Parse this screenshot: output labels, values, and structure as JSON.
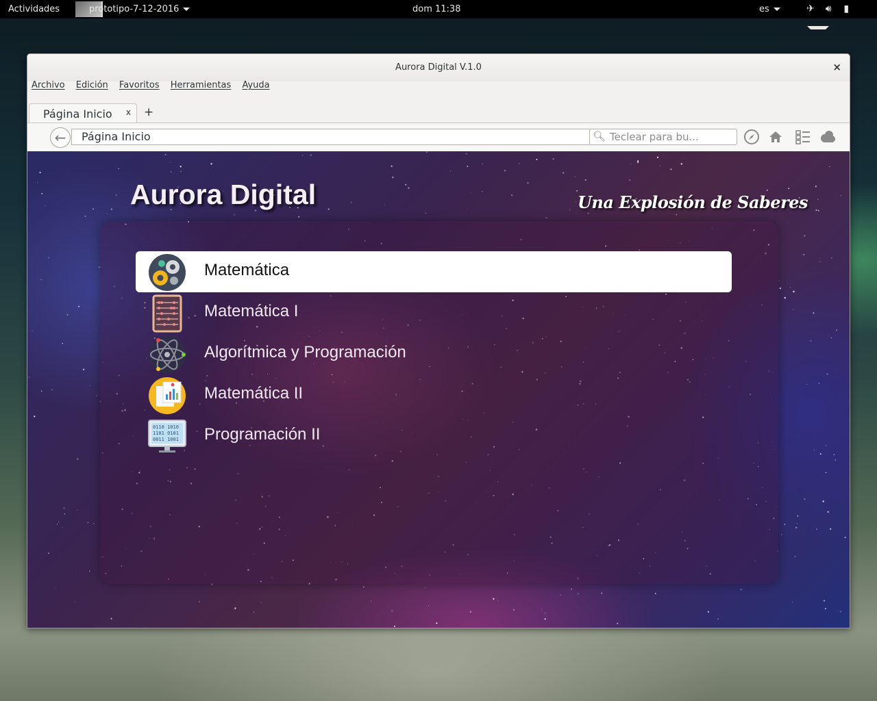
{
  "topbar": {
    "activities": "Actividades",
    "app_name": "prototipo-7-12-2016",
    "clock": "dom 11:38",
    "language": "es",
    "icons": [
      "airplane-mode-icon",
      "volume-icon",
      "battery-icon"
    ]
  },
  "window": {
    "title": "Aurora Digital V.1.0",
    "close": "×"
  },
  "menubar": [
    "Archivo",
    "Edición",
    "Favoritos",
    "Herramientas",
    "Ayuda"
  ],
  "tabs": [
    {
      "label": "Página Inicio",
      "close": "x"
    }
  ],
  "new_tab": "+",
  "navbar": {
    "back": "←",
    "url": "Página Inicio",
    "search_placeholder": "Teclear para bu...",
    "icons": [
      "compass-icon",
      "home-icon",
      "list-icon",
      "cloud-icon"
    ]
  },
  "page": {
    "title": "Aurora Digital",
    "tagline": "Una Explosión de Saberes",
    "courses": [
      {
        "label": "Matemática",
        "icon": "gears-icon",
        "active": true
      },
      {
        "label": "Matemática I",
        "icon": "abacus-icon",
        "active": false
      },
      {
        "label": "Algorítmica y Programación",
        "icon": "atom-icon",
        "active": false
      },
      {
        "label": "Matemática II",
        "icon": "report-chart-icon",
        "active": false
      },
      {
        "label": "Programación II",
        "icon": "binary-monitor-icon",
        "active": false
      }
    ]
  },
  "colors": {
    "active_item_bg": "#ffffff",
    "panel_bg": "#3c143c",
    "page_bg": "#3a2450"
  }
}
